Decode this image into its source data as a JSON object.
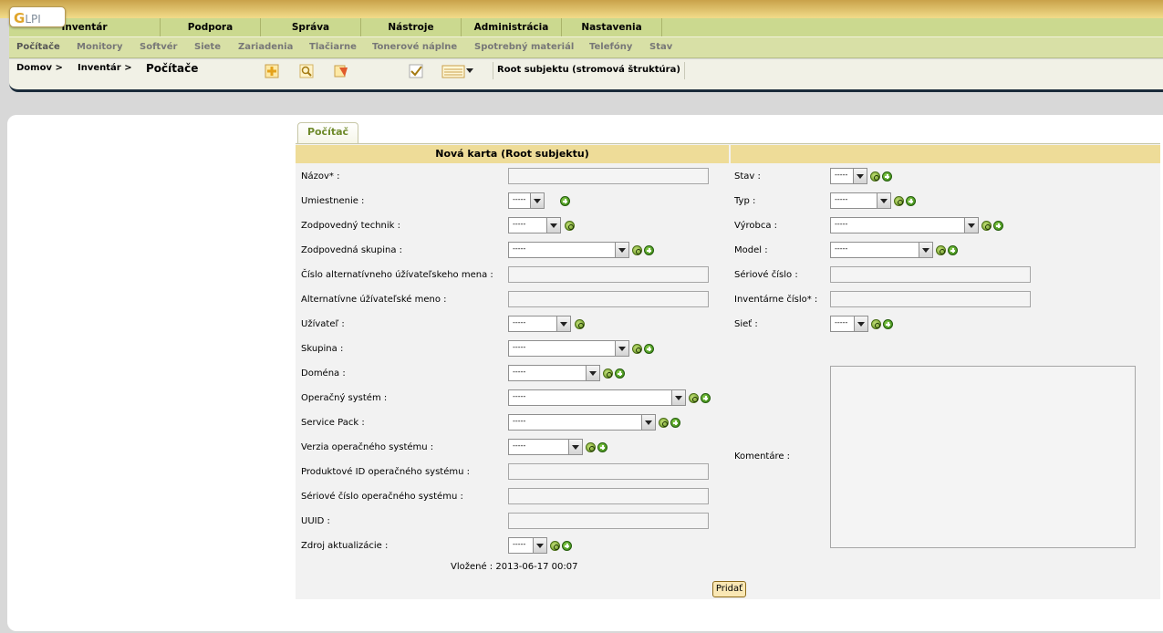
{
  "logo": {
    "g": "G",
    "text": "LPI"
  },
  "mainmenu": [
    "Inventár",
    "Podpora",
    "Správa",
    "Nástroje",
    "Administrácia",
    "Nastavenia"
  ],
  "submenu": [
    "Počítače",
    "Monitory",
    "Softvér",
    "Siete",
    "Zariadenia",
    "Tlačiarne",
    "Tonerové náplne",
    "Spotrebný materiál",
    "Telefóny",
    "Stav"
  ],
  "breadcrumb": {
    "home": "Domov >",
    "inventory": "Inventár >",
    "current": "Počítače"
  },
  "toolbar": {
    "icons": [
      "add-icon",
      "search-icon",
      "template-icon",
      "check-icon",
      "list-display-icon"
    ],
    "root": "Root subjektu (stromová štruktúra)"
  },
  "tab": "Počítač",
  "form": {
    "header": "Nová karta (Root subjektu)",
    "select_default": "-----",
    "left": [
      {
        "label": "Názov* :"
      },
      {
        "label": "Umiestnenie :"
      },
      {
        "label": "Zodpovedný technik :"
      },
      {
        "label": "Zodpovedná skupina :"
      },
      {
        "label": "Číslo alternatívneho úžívateľskeho mena :"
      },
      {
        "label": "Alternatívne úžívateľské meno :"
      },
      {
        "label": "Užívateľ :"
      },
      {
        "label": "Skupina :"
      },
      {
        "label": "Doména :"
      },
      {
        "label": "Operačný systém :"
      },
      {
        "label": "Service Pack :"
      },
      {
        "label": "Verzia operačného systému :"
      },
      {
        "label": "Produktové ID operačného systému :"
      },
      {
        "label": "Sériové číslo operačného systému :"
      },
      {
        "label": "UUID :"
      },
      {
        "label": "Zdroj aktualizácie :"
      }
    ],
    "right": [
      {
        "label": "Stav :"
      },
      {
        "label": "Typ :"
      },
      {
        "label": "Výrobca :"
      },
      {
        "label": "Model :"
      },
      {
        "label": "Sériové číslo :"
      },
      {
        "label": "Inventárne číslo* :"
      },
      {
        "label": "Sieť :"
      }
    ],
    "comment_label": "Komentáre :",
    "inserted": "Vložené : 2013-06-17 00:07",
    "submit": "Pridať"
  }
}
